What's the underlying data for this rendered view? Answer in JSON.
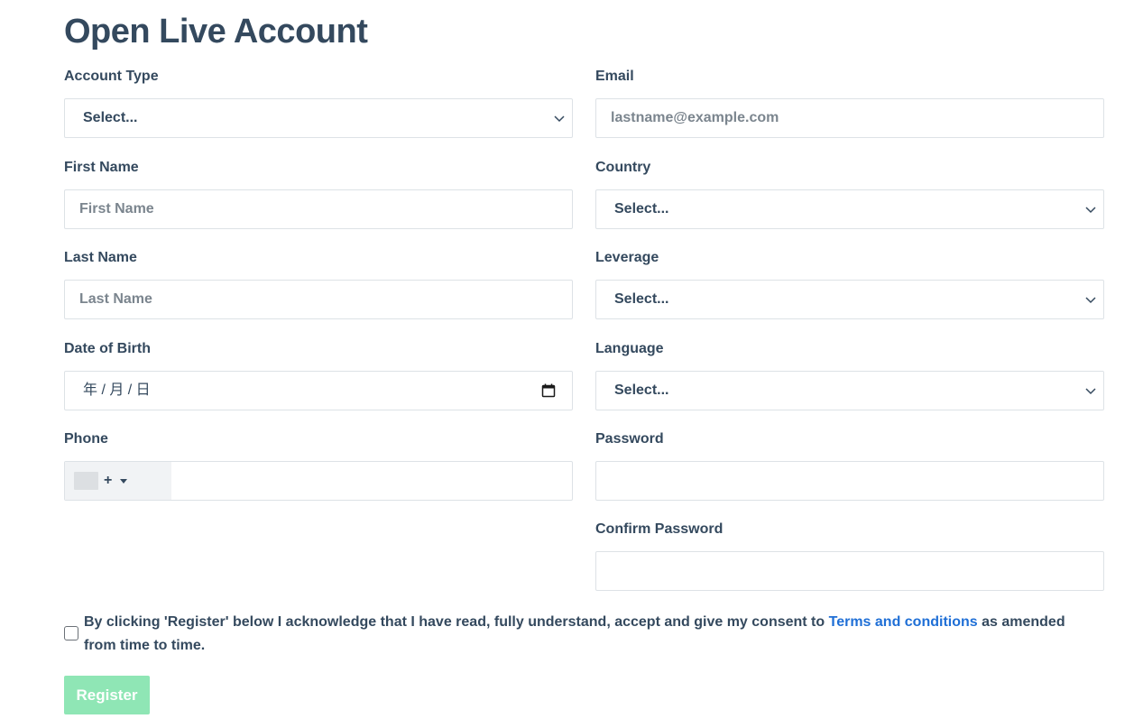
{
  "page": {
    "title": "Open Live Account"
  },
  "form": {
    "account_type": {
      "label": "Account Type",
      "value": "Select..."
    },
    "email": {
      "label": "Email",
      "placeholder": "lastname@example.com"
    },
    "first_name": {
      "label": "First Name",
      "placeholder": "First Name"
    },
    "country": {
      "label": "Country",
      "value": "Select..."
    },
    "last_name": {
      "label": "Last Name",
      "placeholder": "Last Name"
    },
    "leverage": {
      "label": "Leverage",
      "value": "Select..."
    },
    "date_of_birth": {
      "label": "Date of Birth",
      "value": "年 / 月 / 日"
    },
    "language": {
      "label": "Language",
      "value": "Select..."
    },
    "phone": {
      "label": "Phone",
      "prefix": "+"
    },
    "password": {
      "label": "Password"
    },
    "confirm_password": {
      "label": "Confirm Password"
    }
  },
  "consent": {
    "text_before": "By clicking 'Register' below I acknowledge that I have read, fully understand, accept and give my consent to ",
    "link": "Terms and conditions",
    "text_after": " as amended from time to time."
  },
  "actions": {
    "register_label": "Register"
  },
  "colors": {
    "text": "#34495e",
    "link": "#1f6fd6",
    "button_disabled": "#8fe6b5",
    "border": "#dde2e6"
  },
  "icons": {
    "select_arrow": "chevron-down-icon",
    "date_picker": "calendar-icon",
    "phone_flag": "flag-icon",
    "phone_dropdown": "caret-down-icon"
  }
}
